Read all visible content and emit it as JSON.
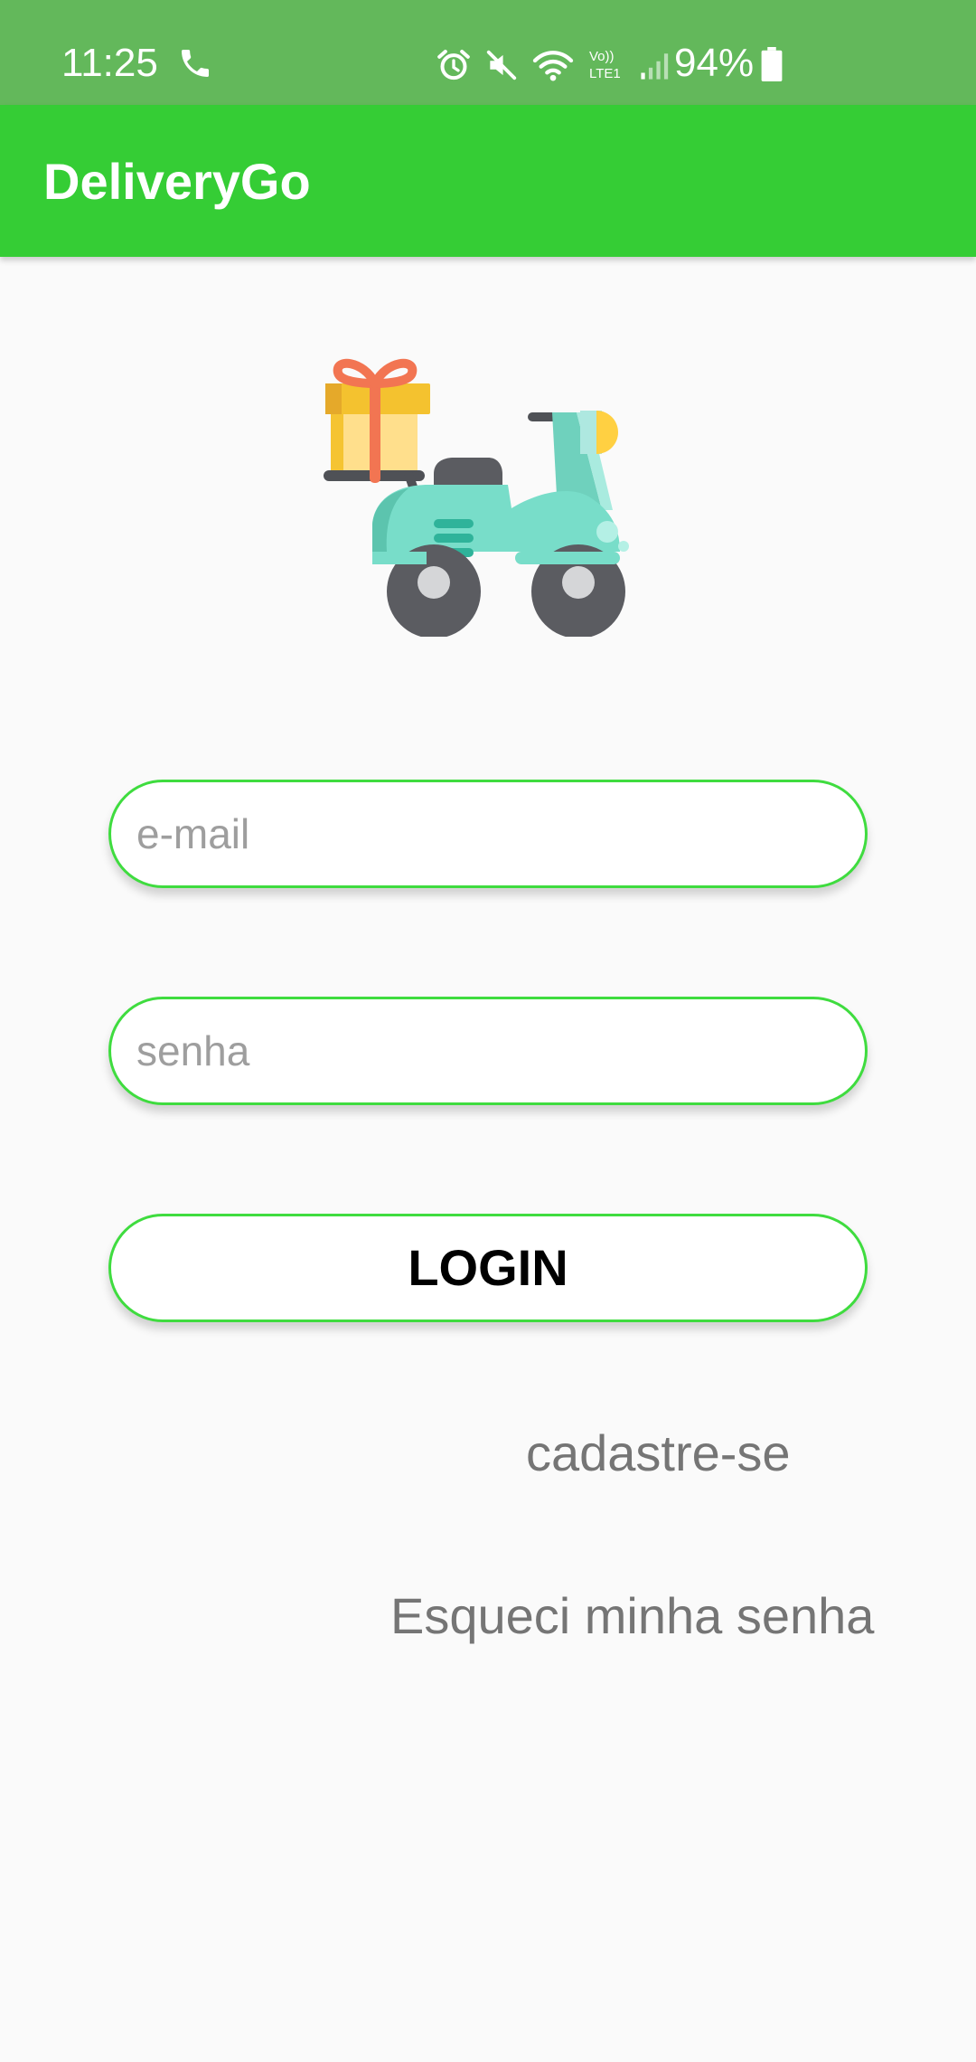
{
  "status_bar": {
    "time": "11:25",
    "battery_percent": "94%",
    "icons": [
      "phone-icon",
      "alarm-icon",
      "mute-icon",
      "wifi-icon",
      "volte-icon",
      "signal-icon",
      "battery-icon"
    ],
    "volte_label_top": "Vo))",
    "volte_label_bottom": "LTE1",
    "background_color": "#63b85b"
  },
  "app_bar": {
    "title": "DeliveryGo",
    "background_color": "#35cd35"
  },
  "logo": {
    "icon": "delivery-scooter-icon"
  },
  "form": {
    "email_placeholder": "e-mail",
    "password_placeholder": "senha",
    "login_label": "LOGIN",
    "accent_color": "#3fdc3f"
  },
  "links": {
    "signup": "cadastre-se",
    "forgot_password": "Esqueci minha senha"
  }
}
